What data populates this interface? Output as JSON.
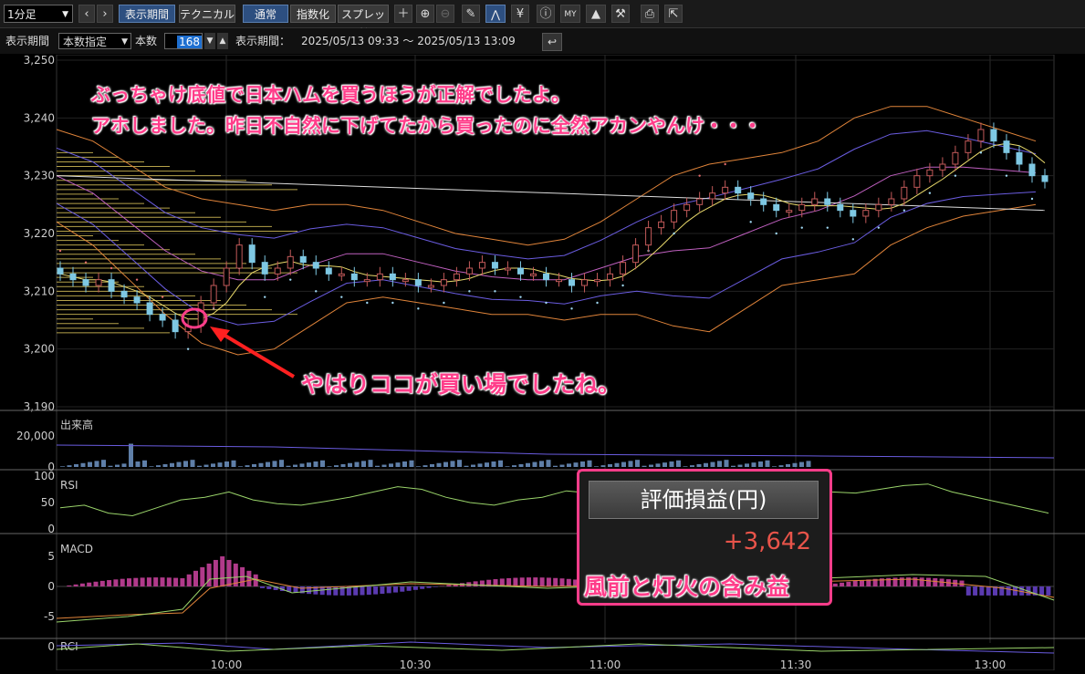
{
  "toolbar": {
    "timeframe": "1分足",
    "view_period": "表示期間",
    "technical": "テクニカル",
    "normal": "通常",
    "index": "指数化",
    "spread": "スプレッド",
    "icons": [
      "crosshair-icon",
      "zoom-in-icon",
      "zoom-out-icon",
      "pencil-icon",
      "chart-tool-icon",
      "yen-icon",
      "info-icon",
      "my-icon",
      "area-chart-icon",
      "wrench-icon",
      "print-icon",
      "export-icon"
    ]
  },
  "period_bar": {
    "label": "表示期間",
    "mode": "本数指定",
    "count_label": "本数",
    "count": "168",
    "range_label": "表示期間：",
    "range": "2025/05/13 09:33 ～ 2025/05/13 13:09"
  },
  "annotations": {
    "top_line1": "ぶっちゃけ底値で日本ハムを買うほうが正解でしたよ。",
    "top_line2": "アホしました。昨日不自然に下げてたから買ったのに全然アカンやんけ・・・",
    "arrow_note": "やはりココが買い場でしたね。",
    "panel_title": "評価損益(円)",
    "panel_value": "+3,642",
    "panel_note": "風前と灯火の含み益"
  },
  "colors": {
    "candle_up": "#c35a5a",
    "candle_down": "#7ec8e3",
    "annotation": "#ff3d8a",
    "profit": "#e8544a"
  },
  "chart_data": [
    {
      "type": "candlestick",
      "title": "",
      "ylim": [
        3190,
        3250
      ],
      "y_ticks": [
        "3,250",
        "3,240",
        "3,230",
        "3,220",
        "3,210",
        "3,200",
        "3,190"
      ],
      "x_ticks": [
        "10:00",
        "10:30",
        "11:00",
        "11:30",
        "13:00"
      ],
      "close_path": [
        3213,
        3212,
        3211,
        3212,
        3210,
        3209,
        3208,
        3206,
        3205,
        3203,
        3204,
        3208,
        3211,
        3214,
        3218,
        3215,
        3213,
        3214,
        3216,
        3215,
        3214,
        3213,
        3213,
        3212,
        3212,
        3213,
        3212,
        3212,
        3211,
        3211,
        3212,
        3213,
        3214,
        3215,
        3214,
        3214,
        3213,
        3213,
        3212,
        3212,
        3211,
        3212,
        3212,
        3213,
        3215,
        3218,
        3221,
        3222,
        3224,
        3225,
        3226,
        3227,
        3228,
        3227,
        3226,
        3225,
        3224,
        3224,
        3225,
        3226,
        3225,
        3224,
        3223,
        3224,
        3225,
        3226,
        3228,
        3230,
        3231,
        3232,
        3234,
        3236,
        3238,
        3236,
        3234,
        3232,
        3230,
        3229
      ],
      "bollinger_upper": [
        3238,
        3236,
        3232,
        3228,
        3226,
        3225,
        3224,
        3225,
        3225,
        3224,
        3222,
        3220,
        3219,
        3218,
        3219,
        3222,
        3226,
        3230,
        3232,
        3233,
        3234,
        3236,
        3240,
        3242,
        3242,
        3240,
        3238,
        3236
      ],
      "bollinger_lower": [
        3222,
        3218,
        3212,
        3206,
        3201,
        3199,
        3200,
        3204,
        3208,
        3209,
        3208,
        3207,
        3206,
        3206,
        3205,
        3206,
        3206,
        3204,
        3203,
        3207,
        3211,
        3212,
        3213,
        3218,
        3221,
        3223,
        3224,
        3225
      ]
    },
    {
      "type": "bar",
      "title": "出来高",
      "ylim": [
        0,
        20000
      ],
      "y_ticks": [
        "20,000",
        "0"
      ]
    },
    {
      "type": "line",
      "title": "RSI",
      "ylim": [
        0,
        100
      ],
      "y_ticks": [
        "100",
        "50",
        "0"
      ],
      "values": [
        40,
        45,
        30,
        25,
        40,
        55,
        60,
        70,
        55,
        48,
        45,
        52,
        60,
        70,
        80,
        75,
        60,
        50,
        45,
        55,
        60,
        72,
        68,
        55,
        50,
        45,
        55,
        65,
        70,
        80,
        75,
        78,
        70,
        68,
        75,
        82,
        85,
        70,
        60,
        50,
        40,
        30
      ]
    },
    {
      "type": "bar",
      "title": "MACD",
      "ylim": [
        -5,
        5
      ],
      "y_ticks": [
        "5",
        "0",
        "-5"
      ]
    },
    {
      "type": "line",
      "title": "RCI",
      "y_ticks": [
        "0"
      ]
    }
  ]
}
